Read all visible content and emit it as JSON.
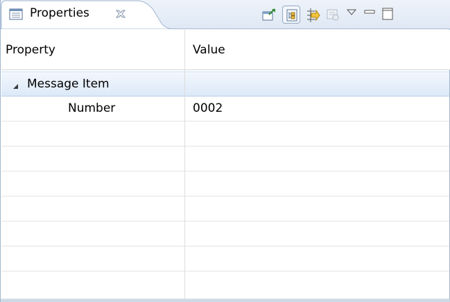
{
  "view": {
    "tab_title": "Properties",
    "tab_icon": "properties-icon",
    "close_icon": "close-icon"
  },
  "toolbar": {
    "items": [
      {
        "icon": "pin-to-selection-icon"
      },
      {
        "icon": "show-categories-icon",
        "pressed": true
      },
      {
        "icon": "show-advanced-properties-icon"
      },
      {
        "icon": "restore-default-value-icon"
      },
      {
        "icon": "view-menu-icon"
      },
      {
        "icon": "minimize-icon"
      },
      {
        "icon": "maximize-icon"
      }
    ]
  },
  "table": {
    "columns": [
      "Property",
      "Value"
    ],
    "rows": [
      {
        "property": "Message Item",
        "value": "",
        "category": true,
        "expanded": true
      },
      {
        "property": "Number",
        "value": "0002",
        "category": false
      }
    ]
  },
  "colors": {
    "selection_top": "#f2f7fd",
    "selection_bottom": "#dce9f8",
    "header_border": "#a7bad1"
  }
}
